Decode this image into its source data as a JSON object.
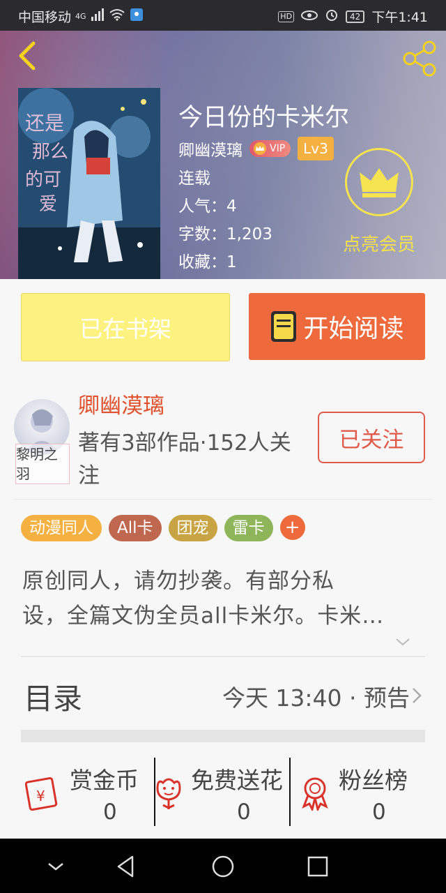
{
  "status_bar": {
    "carrier": "中国移动",
    "net_type": "4G",
    "hd": "HD",
    "battery": "42",
    "time": "下午1:41"
  },
  "header": {
    "back_icon": "back-arrow-icon",
    "share_icon": "share-icon",
    "accent_color": "#f5d21c"
  },
  "book": {
    "title": "今日份的卡米尔",
    "author": "卿幽漠璃",
    "vip_label": "VIP",
    "level": "Lv3",
    "status": "连载",
    "popularity": "人气：4",
    "word_count": "字数：1,203",
    "favorites": "收藏：1"
  },
  "member": {
    "label": "点亮会员",
    "icon": "crown-icon"
  },
  "actions": {
    "on_shelf_label": "已在书架",
    "read_label": "开始阅读",
    "read_icon": "book-icon",
    "read_color": "#ee6a3c",
    "shelf_color": "#fdf27f"
  },
  "author_card": {
    "avatar_caption": "黎明之羽",
    "name": "卿幽漠璃",
    "stats": "著有3部作品·152人关注",
    "follow_label": "已关注"
  },
  "tags": [
    {
      "label": "动漫同人",
      "color": "#f5b042"
    },
    {
      "label": "All卡",
      "color": "#c0684f"
    },
    {
      "label": "团宠",
      "color": "#c9a444"
    },
    {
      "label": "雷卡",
      "color": "#8fb55b"
    }
  ],
  "tag_add": "+",
  "description": {
    "line1": "原创同人，请勿抄袭。有部分私",
    "line2": "设，全篇文伪全员all卡米尔。卡米…"
  },
  "toc": {
    "title": "目录",
    "latest": "今天 13:40 · 预告"
  },
  "bottom": {
    "reward_label": "赏金币",
    "reward_count": "0",
    "flower_label": "免费送花",
    "flower_count": "0",
    "fans_label": "粉丝榜",
    "fans_count": "0"
  },
  "nav": {
    "back": "nav-back-icon",
    "home": "nav-home-icon",
    "recent": "nav-recent-icon",
    "down": "nav-down-icon"
  }
}
